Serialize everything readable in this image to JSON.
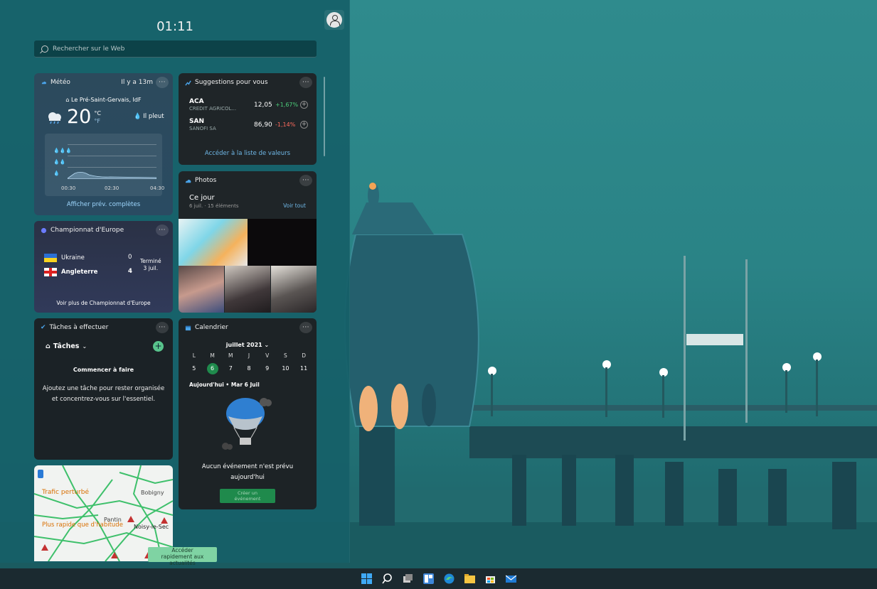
{
  "panel": {
    "clock": "01:11",
    "search_placeholder": "Rechercher sur le Web"
  },
  "weather": {
    "title": "Météo",
    "updated": "Il y a 13m",
    "location": "Le Pré-Saint-Gervais, IdF",
    "temperature": "20",
    "unit_c": "°C",
    "unit_f": "°F",
    "condition": "Il pleut",
    "chart_times": [
      "00:30",
      "02:30",
      "04:30"
    ],
    "link": "Afficher prév. complètes"
  },
  "stocks": {
    "title": "Suggestions pour vous",
    "items": [
      {
        "symbol": "ACA",
        "name": "CREDIT AGRICOL...",
        "price": "12,05",
        "change": "+1,67%",
        "color": "#4ccd7a"
      },
      {
        "symbol": "SAN",
        "name": "SANOFI SA",
        "price": "86,90",
        "change": "-1,14%",
        "color": "#ff6b5e"
      }
    ],
    "link": "Accéder à la liste de valeurs"
  },
  "euro": {
    "title": "Championnat d'Europe",
    "teams": [
      {
        "name": "Ukraine",
        "score": "0"
      },
      {
        "name": "Angleterre",
        "score": "4"
      }
    ],
    "status_line1": "Terminé",
    "status_line2": "3 juil.",
    "link": "Voir plus de Championnat d'Europe"
  },
  "photos": {
    "title": "Photos",
    "subtitle": "Ce jour",
    "meta": "6 juil. · 15 éléments",
    "see_all": "Voir tout"
  },
  "tasks": {
    "title": "Tâches à effectuer",
    "list_name": "Tâches",
    "start": "Commencer à faire",
    "hint": "Ajoutez une tâche pour rester organisée et concentrez-vous sur l'essentiel."
  },
  "calendar": {
    "title": "Calendrier",
    "month": "juillet 2021",
    "day_headers": [
      "L",
      "M",
      "M",
      "J",
      "V",
      "S",
      "D"
    ],
    "days": [
      "5",
      "6",
      "7",
      "8",
      "9",
      "10",
      "11"
    ],
    "today_label": "Aujourd'hui • Mar 6 Juil",
    "empty_line1": "Aucun événement n'est prévu",
    "empty_line2": "aujourd'hui",
    "create_line1": "Créer un",
    "create_line2": "événement"
  },
  "traffic": {
    "label1": "Trafic perturbé",
    "label2": "Plus rapide que d'habitude",
    "places": [
      "Bobigny",
      "Pantin",
      "Noisy-le-Sec"
    ]
  },
  "news_button": {
    "line1": "Accéder",
    "line2": "rapidement aux",
    "line3": "actualités"
  },
  "taskbar": {
    "icons": [
      "start-icon",
      "search-icon",
      "task-view-icon",
      "widgets-icon",
      "edge-icon",
      "file-explorer-icon",
      "store-icon",
      "mail-icon"
    ]
  }
}
